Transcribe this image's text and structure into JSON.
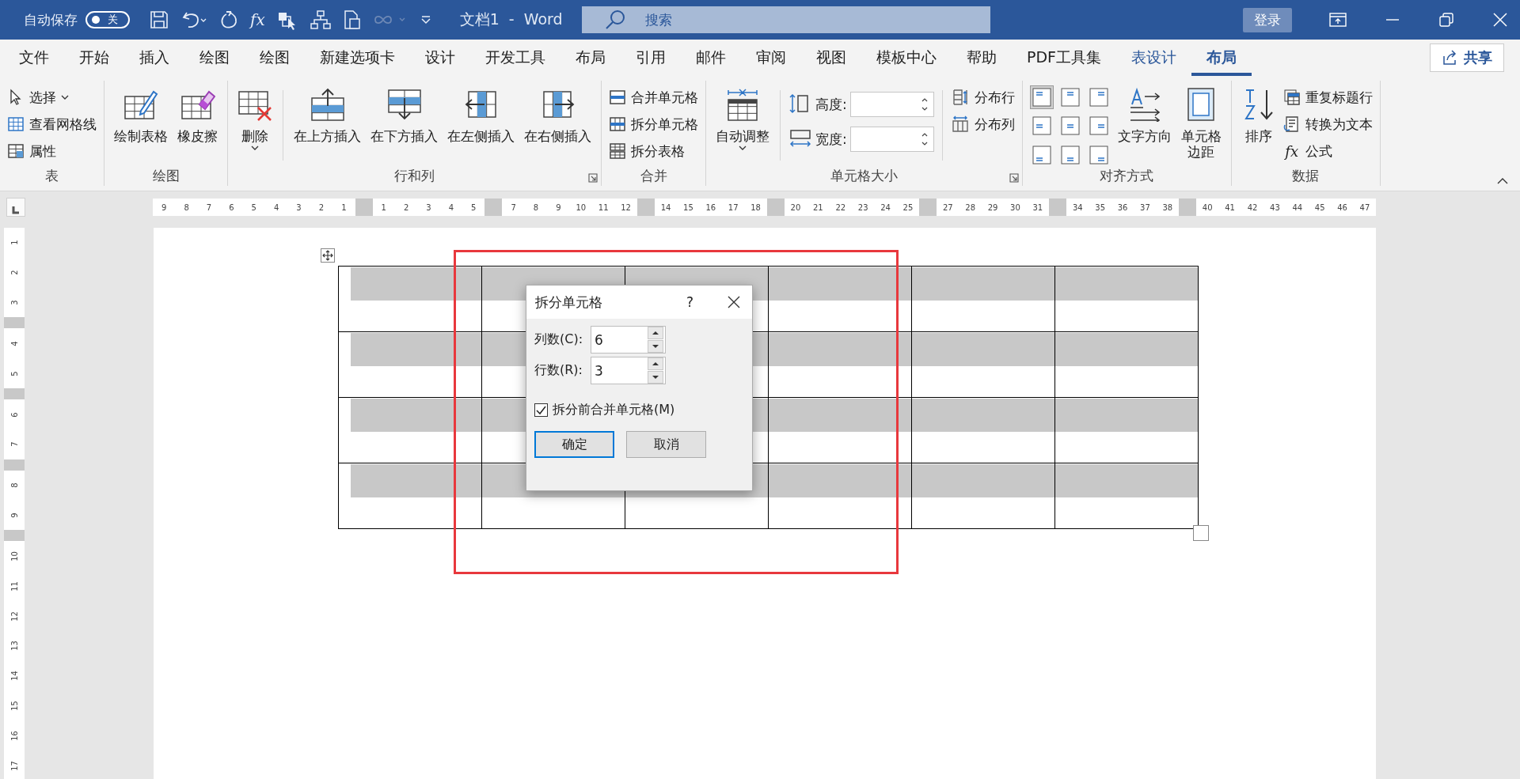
{
  "title_bar": {
    "autosave_label": "自动保存",
    "autosave": {
      "on": false,
      "label": "关"
    },
    "formula_icon_text": "fx",
    "document_title": "文档1  -  Word",
    "search": {
      "placeholder": "搜索"
    },
    "sign_in": "登录"
  },
  "tabs": [
    {
      "label": "文件",
      "selected": false,
      "kind": "normal"
    },
    {
      "label": "开始",
      "selected": false,
      "kind": "normal"
    },
    {
      "label": "插入",
      "selected": false,
      "kind": "normal"
    },
    {
      "label": "绘图",
      "selected": false,
      "kind": "normal"
    },
    {
      "label": "绘图",
      "selected": false,
      "kind": "normal"
    },
    {
      "label": "新建选项卡",
      "selected": false,
      "kind": "normal"
    },
    {
      "label": "设计",
      "selected": false,
      "kind": "normal"
    },
    {
      "label": "开发工具",
      "selected": false,
      "kind": "normal"
    },
    {
      "label": "布局",
      "selected": false,
      "kind": "normal"
    },
    {
      "label": "引用",
      "selected": false,
      "kind": "normal"
    },
    {
      "label": "邮件",
      "selected": false,
      "kind": "normal"
    },
    {
      "label": "审阅",
      "selected": false,
      "kind": "normal"
    },
    {
      "label": "视图",
      "selected": false,
      "kind": "normal"
    },
    {
      "label": "模板中心",
      "selected": false,
      "kind": "normal"
    },
    {
      "label": "帮助",
      "selected": false,
      "kind": "normal"
    },
    {
      "label": "PDF工具集",
      "selected": false,
      "kind": "normal"
    },
    {
      "label": "表设计",
      "selected": false,
      "kind": "contextual"
    },
    {
      "label": "布局",
      "selected": true,
      "kind": "contextual"
    }
  ],
  "share": "共享",
  "ribbon": {
    "groups": [
      {
        "label": "表",
        "columns": [
          {
            "kind": "stack",
            "items": [
              {
                "label": "选择",
                "dropdown": true
              },
              {
                "label": "查看网格线"
              },
              {
                "label": "属性"
              }
            ]
          }
        ]
      },
      {
        "label": "绘图",
        "columns": [
          {
            "kind": "large",
            "lines": [
              "绘制表格"
            ]
          },
          {
            "kind": "large",
            "lines": [
              "橡皮擦"
            ]
          }
        ]
      },
      {
        "label": "行和列",
        "launcher": true,
        "columns": [
          {
            "kind": "large",
            "lines": [
              "删除"
            ],
            "dropdown": true
          },
          {
            "kind": "divider"
          },
          {
            "kind": "large",
            "lines": [
              "在上方插入"
            ]
          },
          {
            "kind": "large",
            "lines": [
              "在下方插入"
            ]
          },
          {
            "kind": "large",
            "lines": [
              "在左侧插入"
            ]
          },
          {
            "kind": "large",
            "lines": [
              "在右侧插入"
            ]
          }
        ]
      },
      {
        "label": "合并",
        "columns": [
          {
            "kind": "stack",
            "items": [
              {
                "label": "合并单元格"
              },
              {
                "label": "拆分单元格"
              },
              {
                "label": "拆分表格"
              }
            ]
          }
        ]
      },
      {
        "label": "单元格大小",
        "launcher": true,
        "columns": [
          {
            "kind": "large",
            "lines": [
              "自动调整"
            ],
            "dropdown": true
          },
          {
            "kind": "divider"
          },
          {
            "kind": "fields",
            "items": [
              {
                "label": "高度:"
              },
              {
                "label": "宽度:"
              }
            ]
          },
          {
            "kind": "divider"
          },
          {
            "kind": "stack",
            "items": [
              {
                "label": "分布行"
              },
              {
                "label": "分布列"
              }
            ]
          }
        ]
      },
      {
        "label": "对齐方式",
        "columns": [
          {
            "kind": "align",
            "cells": [
              {
                "selected": true
              },
              {
                "selected": false
              },
              {
                "selected": false
              },
              {
                "selected": false
              },
              {
                "selected": false
              },
              {
                "selected": false
              },
              {
                "selected": false
              },
              {
                "selected": false
              },
              {
                "selected": false
              }
            ]
          },
          {
            "kind": "large",
            "lines": [
              "文字方向"
            ]
          },
          {
            "kind": "large",
            "lines": [
              "单元格",
              "边距"
            ]
          }
        ]
      },
      {
        "label": "数据",
        "columns": [
          {
            "kind": "large",
            "lines": [
              "排序"
            ]
          },
          {
            "kind": "stack",
            "items": [
              {
                "label": "重复标题行"
              },
              {
                "label": "转换为文本"
              },
              {
                "label": "公式",
                "icon_text": "fx"
              }
            ]
          }
        ]
      }
    ]
  },
  "horizontal_ruler": {
    "segments": [
      [
        "9",
        "8",
        "7",
        "6",
        "5",
        "4",
        "3",
        "2",
        "1"
      ],
      [
        "1",
        "2",
        "3",
        "4",
        "5"
      ],
      [
        "7",
        "8",
        "9",
        "10",
        "11",
        "12"
      ],
      [
        "14",
        "15",
        "16",
        "17",
        "18"
      ],
      [
        "20",
        "21",
        "22",
        "23",
        "24",
        "25"
      ],
      [
        "27",
        "28",
        "29",
        "30",
        "31"
      ],
      [
        "34",
        "35",
        "36",
        "37",
        "38"
      ],
      [
        "40",
        "41",
        "42",
        "43",
        "44",
        "45",
        "46",
        "47"
      ]
    ]
  },
  "vertical_ruler": {
    "segments": [
      [
        "1",
        "2",
        "3"
      ],
      [
        "4",
        "5"
      ],
      [
        "6",
        "7"
      ],
      [
        "8",
        "9"
      ],
      [
        "10",
        "11",
        "12",
        "13",
        "14",
        "15",
        "16",
        "17"
      ]
    ]
  },
  "table": {
    "rows": [
      [
        {
          "selected": true
        },
        {
          "selected": true
        },
        {
          "selected": true
        },
        {
          "selected": true
        },
        {
          "selected": true
        },
        {
          "selected": true
        }
      ],
      [
        {
          "selected": true
        },
        {
          "selected": true
        },
        {
          "selected": true
        },
        {
          "selected": true
        },
        {
          "selected": true
        },
        {
          "selected": true
        }
      ],
      [
        {
          "selected": true
        },
        {
          "selected": true
        },
        {
          "selected": true
        },
        {
          "selected": true
        },
        {
          "selected": true
        },
        {
          "selected": true
        }
      ],
      [
        {
          "selected": true
        },
        {
          "selected": true
        },
        {
          "selected": true
        },
        {
          "selected": true
        },
        {
          "selected": true
        },
        {
          "selected": true
        }
      ]
    ]
  },
  "dialog": {
    "title": "拆分单元格",
    "help": "?",
    "fields": [
      {
        "label": "列数(C):",
        "value": "6"
      },
      {
        "label": "行数(R):",
        "value": "3"
      }
    ],
    "checkbox": {
      "label": "拆分前合并单元格(M)",
      "checked": true
    },
    "buttons": [
      {
        "label": "确定",
        "kind": "default"
      },
      {
        "label": "取消",
        "kind": "normal"
      }
    ]
  }
}
